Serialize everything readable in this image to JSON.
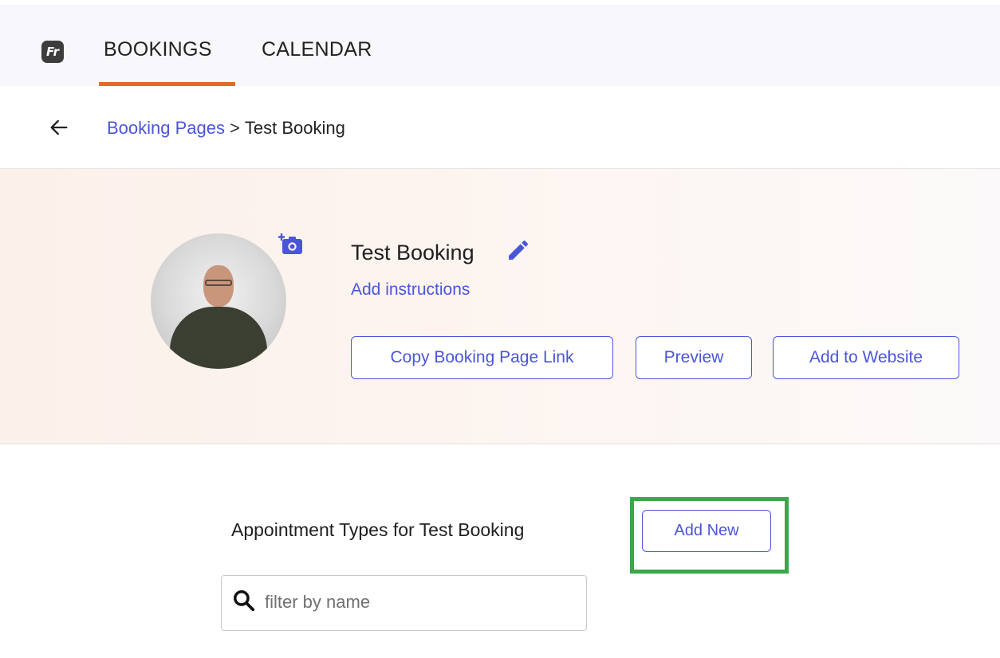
{
  "nav": {
    "logo_text": "Fr",
    "tabs": [
      {
        "label": "BOOKINGS",
        "active": true
      },
      {
        "label": "CALENDAR",
        "active": false
      }
    ]
  },
  "breadcrumb": {
    "parent": "Booking Pages",
    "separator": ">",
    "current": "Test Booking"
  },
  "booking": {
    "title": "Test Booking",
    "add_instructions": "Add instructions",
    "buttons": {
      "copy_link": "Copy Booking Page Link",
      "preview": "Preview",
      "add_to_website": "Add to Website"
    }
  },
  "appointments": {
    "heading": "Appointment Types for Test Booking",
    "add_new": "Add New",
    "filter_placeholder": "filter by name",
    "filter_value": ""
  },
  "icons": {
    "back": "arrow-left-icon",
    "camera": "add-photo-icon",
    "edit": "pencil-icon",
    "search": "search-icon"
  },
  "colors": {
    "accent": "#4b55d8",
    "tab_indicator": "#e26a2c",
    "highlight": "#3aa84a",
    "header_bg": "#fcf0ea"
  }
}
